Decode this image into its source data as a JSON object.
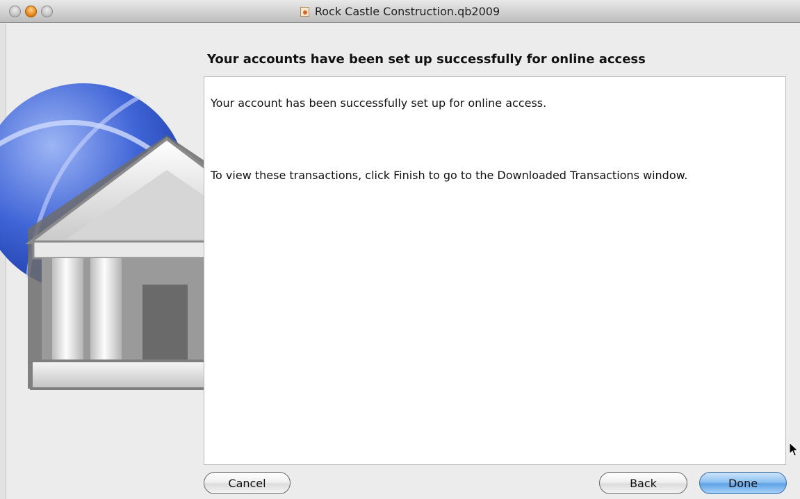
{
  "window": {
    "title": "Rock Castle Construction.qb2009",
    "title_icon": "document-icon"
  },
  "heading": "Your accounts have been set up successfully for online access",
  "message": {
    "line1": "Your account has been successfully set up for online access.",
    "line2": "To view these transactions, click Finish to go to the Downloaded Transactions window."
  },
  "buttons": {
    "cancel": "Cancel",
    "back": "Back",
    "done": "Done"
  },
  "colors": {
    "accent_button": "#6aa8ea",
    "globe": "#3f64d6"
  }
}
